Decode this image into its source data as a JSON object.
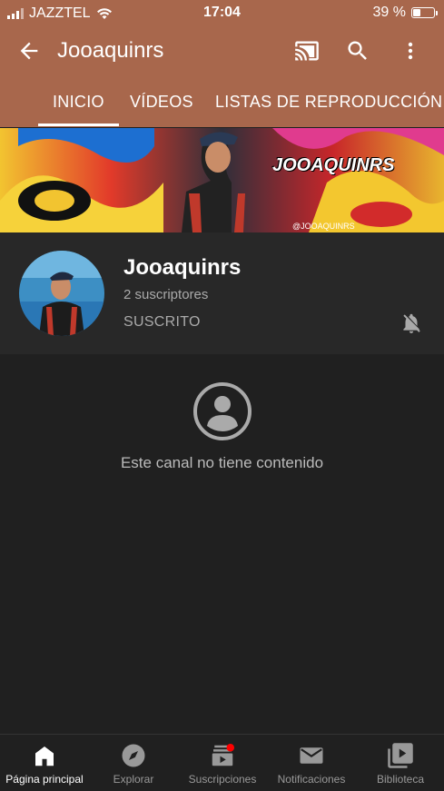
{
  "status": {
    "carrier": "JAZZTEL",
    "time": "17:04",
    "battery": "39 %",
    "battery_level": 0.39
  },
  "topbar": {
    "title": "Jooaquinrs"
  },
  "tabs": [
    {
      "label": "INICIO",
      "active": true
    },
    {
      "label": "VÍDEOS",
      "active": false
    },
    {
      "label": "LISTAS DE REPRODUCCIÓN",
      "active": false
    }
  ],
  "banner": {
    "watermark": "JOOAQUINRS",
    "handle": "@JOOAQUINRS"
  },
  "channel": {
    "name": "Jooaquinrs",
    "subscribers": "2 suscriptores",
    "subscribed_label": "SUSCRITO"
  },
  "empty": {
    "message": "Este canal no tiene contenido"
  },
  "bottom_nav": [
    {
      "label": "Página principal",
      "icon": "home-icon",
      "active": true
    },
    {
      "label": "Explorar",
      "icon": "compass-icon",
      "active": false
    },
    {
      "label": "Suscripciones",
      "icon": "subscriptions-icon",
      "active": false
    },
    {
      "label": "Notificaciones",
      "icon": "mail-icon",
      "active": false
    },
    {
      "label": "Biblioteca",
      "icon": "library-icon",
      "active": false
    }
  ],
  "colors": {
    "header": "#a8674c",
    "background": "#202020",
    "card": "#282828",
    "badge": "#ff0000"
  }
}
